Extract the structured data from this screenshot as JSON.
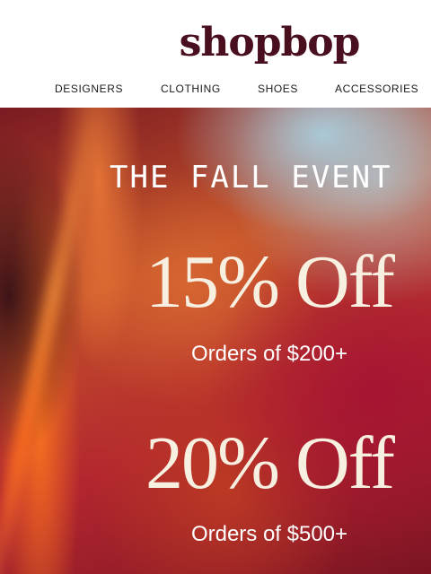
{
  "header": {
    "logo_text": "shopbop",
    "brand_color": "#4a0f1e",
    "nav": [
      {
        "label": "DESIGNERS"
      },
      {
        "label": "CLOTHING"
      },
      {
        "label": "SHOES"
      },
      {
        "label": "ACCESSORIES"
      }
    ]
  },
  "hero": {
    "title": "THE FALL EVENT",
    "offers": [
      {
        "discount": "15% Off",
        "condition": "Orders of $200+"
      },
      {
        "discount": "20% Off",
        "condition": "Orders of $500+"
      }
    ],
    "colors": {
      "discount_text": "#f7efe0",
      "accent_red": "#b3262f",
      "accent_orange": "#c2502a",
      "accent_blue": "#aacddc"
    }
  }
}
